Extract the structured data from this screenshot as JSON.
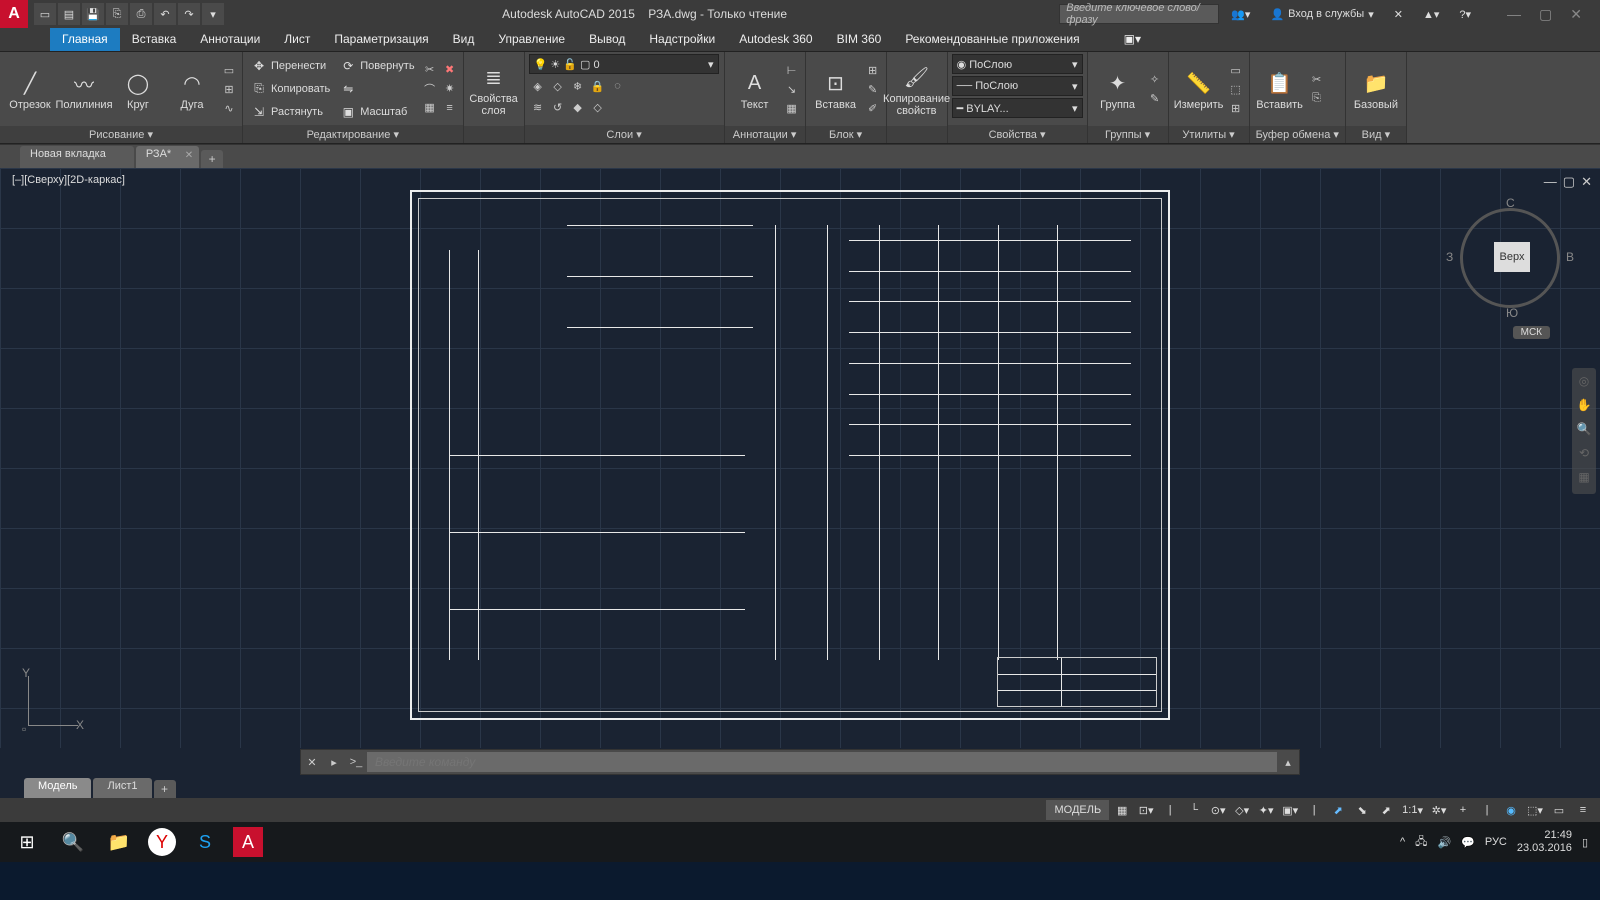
{
  "titlebar": {
    "app": "Autodesk AutoCAD 2015",
    "doc": "РЗА.dwg - Только чтение",
    "search_placeholder": "Введите ключевое слово/фразу",
    "signin": "Вход в службы"
  },
  "tabs": [
    "Главная",
    "Вставка",
    "Аннотации",
    "Лист",
    "Параметризация",
    "Вид",
    "Управление",
    "Вывод",
    "Надстройки",
    "Autodesk 360",
    "BIM 360",
    "Рекомендованные приложения"
  ],
  "activeTab": 0,
  "panels": {
    "draw": {
      "title": "Рисование ▾",
      "items": [
        "Отрезок",
        "Полилиния",
        "Круг",
        "Дуга"
      ]
    },
    "modify": {
      "title": "Редактирование ▾",
      "move": "Перенести",
      "rotate": "Повернуть",
      "copy": "Копировать",
      "stretch": "Растянуть",
      "scale": "Масштаб"
    },
    "layerprops": {
      "title": "",
      "big": "Свойства\nслоя"
    },
    "layers": {
      "title": "Слои ▾",
      "value": "0"
    },
    "text": {
      "title": "Аннотации ▾",
      "big": "Текст"
    },
    "block": {
      "title": "Блок ▾",
      "big": "Вставка",
      "big2": "Копирование\nсвойств"
    },
    "props": {
      "title": "Свойства ▾",
      "color": "ПоСлою",
      "lt": "ПоСлою",
      "lw": "BYLAY..."
    },
    "groups": {
      "title": "Группы ▾",
      "big": "Группа"
    },
    "utils": {
      "title": "Утилиты ▾",
      "big": "Измерить"
    },
    "clip": {
      "title": "Буфер обмена ▾",
      "big": "Вставить"
    },
    "view": {
      "title": "Вид ▾",
      "big": "Базовый"
    }
  },
  "filetabs": [
    {
      "label": "Новая вкладка",
      "active": false
    },
    {
      "label": "РЗА*",
      "active": true
    }
  ],
  "viewport": {
    "label": "[–][Сверху][2D-каркас]",
    "cube": {
      "top": "Верх",
      "n": "С",
      "s": "Ю",
      "e": "В",
      "w": "З",
      "wcs": "МСК"
    }
  },
  "axis": {
    "x": "X",
    "y": "Y"
  },
  "cmdline": {
    "placeholder": "Введите команду",
    "chevron": ">_"
  },
  "modeltabs": [
    {
      "label": "Модель",
      "active": true
    },
    {
      "label": "Лист1",
      "active": false
    }
  ],
  "statusbar": {
    "model": "МОДЕЛЬ",
    "scale": "1:1"
  },
  "taskbar": {
    "lang": "РУС",
    "time": "21:49",
    "date": "23.03.2016"
  }
}
